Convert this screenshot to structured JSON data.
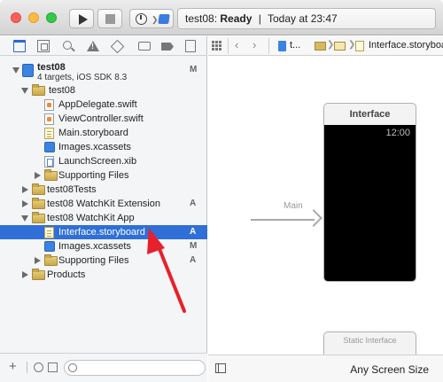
{
  "window": {
    "activity_project": "test08:",
    "activity_status": "Ready",
    "activity_sep": "|",
    "activity_time": "Today at 23:47"
  },
  "navigator": {
    "items": [
      {
        "label": "test08",
        "sub": "4 targets, iOS SDK 8.3",
        "badge": "M",
        "icon": "project-icon",
        "disclosure": "open"
      },
      {
        "label": "test08",
        "icon": "folder-icon",
        "disclosure": "open"
      },
      {
        "label": "AppDelegate.swift",
        "icon": "swift-file-icon"
      },
      {
        "label": "ViewController.swift",
        "icon": "swift-file-icon"
      },
      {
        "label": "Main.storyboard",
        "icon": "storyboard-icon"
      },
      {
        "label": "Images.xcassets",
        "icon": "asset-catalog-icon"
      },
      {
        "label": "LaunchScreen.xib",
        "icon": "xib-icon"
      },
      {
        "label": "Supporting Files",
        "icon": "folder-icon",
        "disclosure": "closed"
      },
      {
        "label": "test08Tests",
        "icon": "folder-icon",
        "disclosure": "closed"
      },
      {
        "label": "test08 WatchKit Extension",
        "badge": "A",
        "icon": "folder-icon",
        "disclosure": "closed"
      },
      {
        "label": "test08 WatchKit App",
        "icon": "folder-icon",
        "disclosure": "open"
      },
      {
        "label": "Interface.storyboard",
        "badge": "A",
        "icon": "storyboard-icon",
        "selected": true
      },
      {
        "label": "Images.xcassets",
        "badge": "M",
        "icon": "asset-catalog-icon"
      },
      {
        "label": "Supporting Files",
        "badge": "A",
        "icon": "folder-icon",
        "disclosure": "closed"
      },
      {
        "label": "Products",
        "icon": "folder-icon",
        "disclosure": "closed"
      }
    ]
  },
  "jumpbar": {
    "project": "t...",
    "file": "Interface.storyboard"
  },
  "canvas": {
    "entry_label": "Main",
    "scene_title": "Interface",
    "scene_time": "12:00",
    "scene2_title": "Static Interface"
  },
  "editor_footer": {
    "size_class": "Any Screen Size"
  },
  "colors": {
    "selection": "#2f6fd7",
    "annotation_arrow": "#e8202a"
  }
}
